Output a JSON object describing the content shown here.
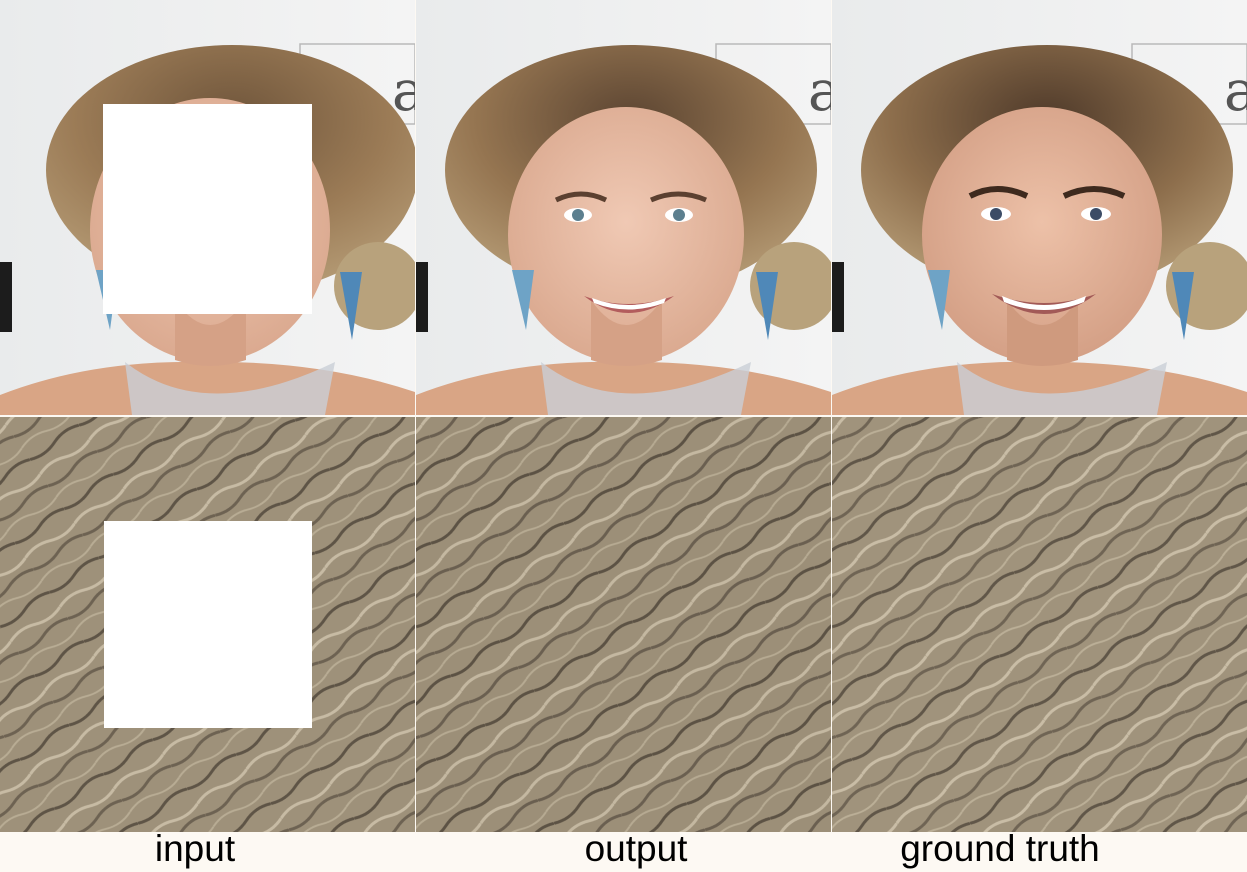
{
  "figure": {
    "columns": [
      {
        "caption": "input"
      },
      {
        "caption": "output"
      },
      {
        "caption": "ground truth"
      }
    ],
    "rows": [
      {
        "content": "portrait-photo"
      },
      {
        "content": "hair-texture"
      }
    ],
    "colors": {
      "background": "#fdf9f3",
      "mask": "#ffffff",
      "studio_backdrop": "#eef0f1",
      "hair": "#8a6d4c",
      "skin": "#e3b69f",
      "texture": "#9e917a"
    },
    "backdrop_text": "a"
  }
}
